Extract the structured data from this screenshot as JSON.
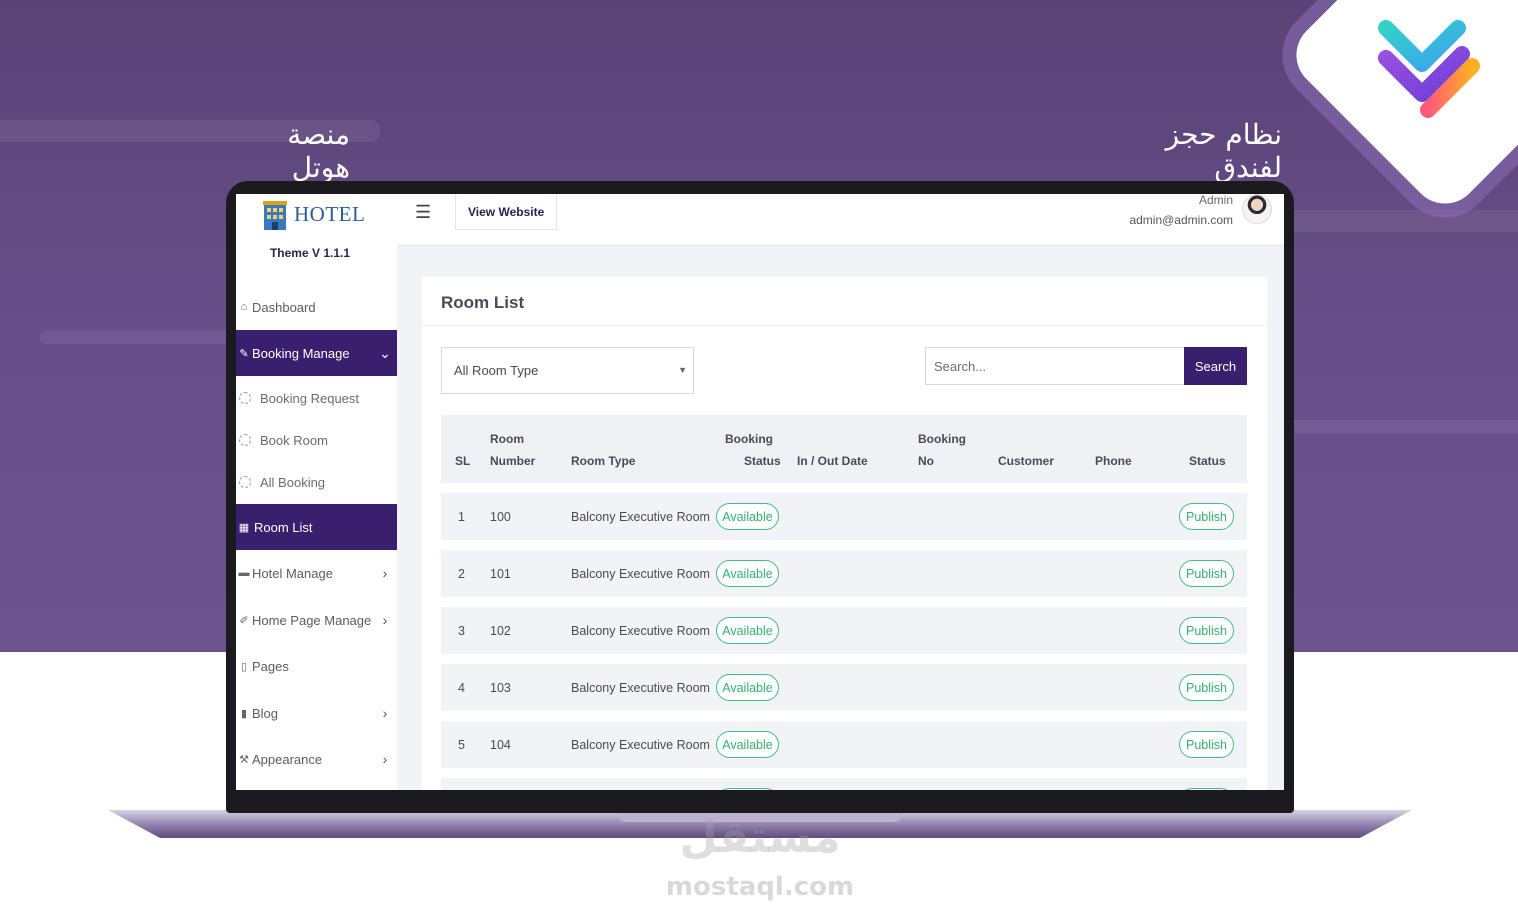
{
  "background": {
    "title_right": "نظام حجز لفندق",
    "title_left": "منصة هوتل",
    "colors": {
      "purple_bg": "#5a4377",
      "accent": "#3a1f6e",
      "status_green": "#34b070"
    }
  },
  "sidebar": {
    "brand": "HOTEL",
    "theme_version": "Theme V 1.1.1",
    "items": [
      {
        "label": "Dashboard",
        "icon": "dashboard-icon"
      },
      {
        "label": "Booking Manage",
        "icon": "pencil-icon",
        "active": true,
        "expanded": true
      },
      {
        "label": "Room List",
        "icon": "grid-icon",
        "active": true
      },
      {
        "label": "Hotel Manage",
        "icon": "bed-icon"
      },
      {
        "label": "Home Page Manage",
        "icon": "edit-icon"
      },
      {
        "label": "Pages",
        "icon": "file-icon"
      },
      {
        "label": "Blog",
        "icon": "blog-icon"
      },
      {
        "label": "Appearance",
        "icon": "brush-icon"
      }
    ],
    "sub_items": [
      {
        "label": "Booking Request"
      },
      {
        "label": "Book Room"
      },
      {
        "label": "All Booking"
      }
    ]
  },
  "topbar": {
    "view_website": "View Website",
    "admin_name": "Admin",
    "admin_email": "admin@admin.com"
  },
  "main": {
    "title": "Room List",
    "filter_selected": "All Room Type",
    "search_placeholder": "Search...",
    "search_button": "Search",
    "columns": {
      "sl": "SL",
      "room_number_1": "Room",
      "room_number_2": "Number",
      "room_type": "Room Type",
      "booking_status_1": "Booking",
      "booking_status_2": "Status",
      "in_out_date": "In / Out Date",
      "booking_no_1": "Booking",
      "booking_no_2": "No",
      "customer": "Customer",
      "phone": "Phone",
      "status": "Status"
    },
    "rows": [
      {
        "sl": "1",
        "room_number": "100",
        "room_type": "Balcony Executive Room",
        "booking_status": "Available",
        "status": "Publish"
      },
      {
        "sl": "2",
        "room_number": "101",
        "room_type": "Balcony Executive Room",
        "booking_status": "Available",
        "status": "Publish"
      },
      {
        "sl": "3",
        "room_number": "102",
        "room_type": "Balcony Executive Room",
        "booking_status": "Available",
        "status": "Publish"
      },
      {
        "sl": "4",
        "room_number": "103",
        "room_type": "Balcony Executive Room",
        "booking_status": "Available",
        "status": "Publish"
      },
      {
        "sl": "5",
        "room_number": "104",
        "room_type": "Balcony Executive Room",
        "booking_status": "Available",
        "status": "Publish"
      }
    ]
  },
  "watermark": {
    "arabic": "مستقل",
    "latin": "mostaql.com"
  }
}
